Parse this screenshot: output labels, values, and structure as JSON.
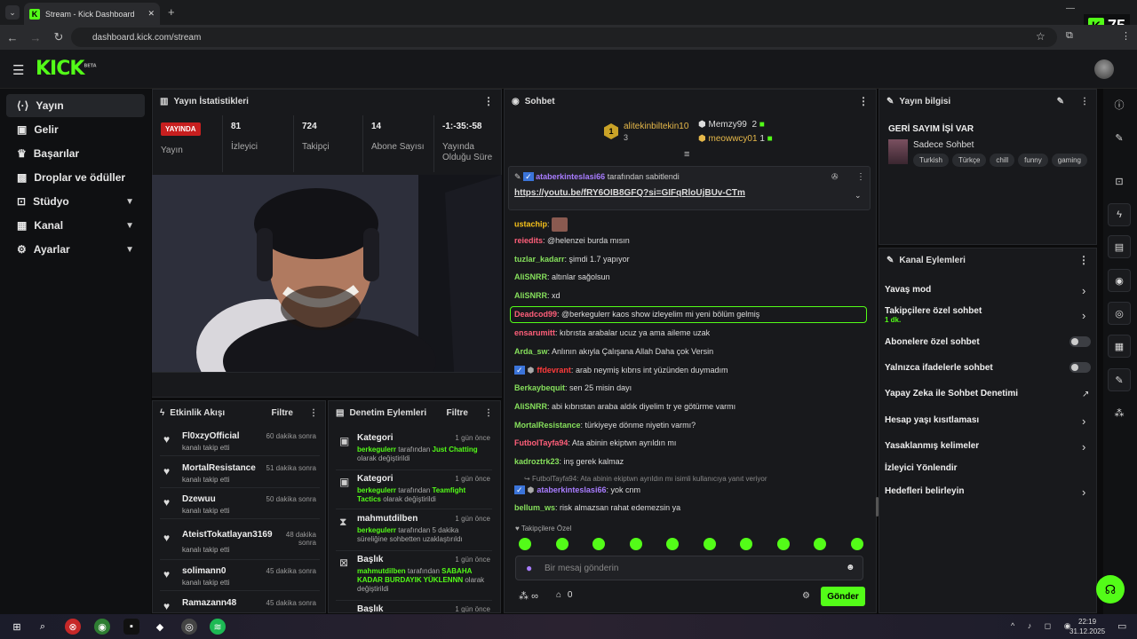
{
  "browser": {
    "tab_title": "Stream - Kick Dashboard",
    "url": "dashboard.kick.com/stream",
    "overlay_number": "75"
  },
  "site": {
    "logo": "KICK",
    "logo_sup": "BETA"
  },
  "nav": [
    {
      "label": "Yayın",
      "icon": "broadcast-icon"
    },
    {
      "label": "Gelir",
      "icon": "wallet-icon"
    },
    {
      "label": "Başarılar",
      "icon": "trophy-icon"
    },
    {
      "label": "Droplar ve ödüller",
      "icon": "gift-icon"
    },
    {
      "label": "Stüdyo",
      "icon": "studio-icon"
    },
    {
      "label": "Kanal",
      "icon": "channel-icon"
    },
    {
      "label": "Ayarlar",
      "icon": "gear-icon"
    }
  ],
  "stats": {
    "title": "Yayın İstatistikleri",
    "live": "YAYINDA",
    "live_label": "Yayın",
    "viewers": "81",
    "viewers_label": "İzleyici",
    "followers": "724",
    "followers_label": "Takipçi",
    "subs": "14",
    "subs_label": "Abone Sayısı",
    "uptime": "-1:-35:-58",
    "uptime_label": "Yayında Olduğu Süre"
  },
  "activity": {
    "title": "Etkinlik Akışı",
    "filter": "Filtre",
    "items": [
      {
        "name": "Fl0xzyOfficial",
        "sub": "kanalı takip etti",
        "time": "60 dakika sonra"
      },
      {
        "name": "MortalResistance",
        "sub": "kanalı takip etti",
        "time": "51 dakika sonra"
      },
      {
        "name": "Dzewuu",
        "sub": "kanalı takip etti",
        "time": "50 dakika sonra"
      },
      {
        "name": "AteistTokatlayan3169",
        "sub": "kanalı takip etti",
        "time": "48 dakika sonra"
      },
      {
        "name": "solimann0",
        "sub": "kanalı takip etti",
        "time": "45 dakika sonra"
      },
      {
        "name": "Ramazann48",
        "sub": "",
        "time": "45 dakika sonra"
      }
    ]
  },
  "mod": {
    "title": "Denetim Eylemleri",
    "filter": "Filtre",
    "items": [
      {
        "title": "Kategori",
        "time": "1 gün önce",
        "user": "berkegulerr",
        "mid": " tarafından ",
        "target": "Just Chatting",
        "end": " olarak değiştirildi"
      },
      {
        "title": "Kategori",
        "time": "1 gün önce",
        "user": "berkegulerr",
        "mid": " tarafından ",
        "target": "Teamfight Tactics",
        "end": " olarak değiştirildi"
      },
      {
        "title": "mahmutdilben",
        "time": "1 gün önce",
        "user": "berkegulerr",
        "mid": " tarafından 5 dakika süreliğine sohbetten uzaklaştırıldı",
        "target": "",
        "end": ""
      },
      {
        "title": "Başlık",
        "time": "1 gün önce",
        "user": "mahmutdilben",
        "mid": " tarafından ",
        "target": "SABAHA KADAR BURDAYIK YÜKLENNN",
        "end": " olarak değiştirildi"
      },
      {
        "title": "Başlık",
        "time": "1 gün önce",
        "user": "",
        "mid": "",
        "target": "",
        "end": ""
      }
    ]
  },
  "chat": {
    "title": "Sohbet",
    "leaders": {
      "first": "alitekinbiltekin10",
      "first_count": "3",
      "second": "Memzy99",
      "second_count": "2",
      "third": "meowwcy01",
      "third_count": "1",
      "rank": "1"
    },
    "pinned_by": "ataberkinteslasi66",
    "pinned_text": "tarafından sabitlendi",
    "pinned_link": "https://youtu.be/fRY6OIB8GFQ?si=GIFqRloUjBUv-CTm",
    "messages": [
      {
        "user": "ustachip",
        "text": "",
        "color": "#f7c21b"
      },
      {
        "user": "reiedits",
        "text": "@helenzei burda mısın",
        "color": "#ff5f7a"
      },
      {
        "user": "tuzlar_kadarr",
        "text": "şimdi 1.7 yapıyor",
        "color": "#86e05c"
      },
      {
        "user": "AliSNRR",
        "text": "altınlar sağolsun",
        "color": "#86e05c"
      },
      {
        "user": "AliSNRR",
        "text": "xd",
        "color": "#86e05c"
      },
      {
        "user": "Deadcod99",
        "text": "@berkegulerr kaos show izleyelim mi yeni bölüm gelmiş",
        "color": "#ff5f7a"
      },
      {
        "user": "ensarumitt",
        "text": "kıbrısta arabalar ucuz ya ama aileme uzak",
        "color": "#ff5f7a"
      },
      {
        "user": "Arda_sw",
        "text": "Anlının akıyla Çalışana Allah Daha çok Versin",
        "color": "#86e05c"
      },
      {
        "user": "ffdevrant",
        "text": "arab neymiş kıbrıs int yüzünden duymadım",
        "color": "#ff3b3b"
      },
      {
        "user": "Berkaybequit",
        "text": "sen 25 misin dayı",
        "color": "#86e05c"
      },
      {
        "user": "AliSNRR",
        "text": "abi kıbrıstan araba aldık diyelim tr ye götürme varmı",
        "color": "#86e05c"
      },
      {
        "user": "MortalResistance",
        "text": "türkiyeye dönme niyetin varmı?",
        "color": "#86e05c"
      },
      {
        "user": "FutbolTayfa94",
        "text": "Ata abinin ekiptwn ayrıldın mı",
        "color": "#ff5f7a"
      },
      {
        "user": "kadroztrk23",
        "text": "inş gerek kalmaz",
        "color": "#86e05c"
      },
      {
        "user": "ataberkinteslasi66",
        "text": "yok cnm",
        "color": "#a87cff"
      },
      {
        "user": "bellum_ws",
        "text": "risk almazsan rahat edemezsin ya",
        "color": "#86e05c"
      }
    ],
    "reply_ref": "FutbolTayfa94: Ata abinin ekiptwn ayrıldın mı isimli kullanıcıya yanıt veriyor",
    "followers_only": "Takipçilere Özel",
    "input_placeholder": "Bir mesaj gönderin",
    "points": "∞",
    "count": "0",
    "send": "Gönder"
  },
  "info": {
    "title": "Yayın bilgisi",
    "stream_title": "GERİ SAYIM İŞİ VAR",
    "category": "Sadece Sohbet",
    "tags": [
      "Turkish",
      "Türkçe",
      "chill",
      "funny",
      "gaming"
    ]
  },
  "channel": {
    "title": "Kanal Eylemleri",
    "items": [
      {
        "label": "Yavaş mod",
        "sub": "",
        "kind": "chevron"
      },
      {
        "label": "Takipçilere özel sohbet",
        "sub": "1 dk.",
        "kind": "chevron"
      },
      {
        "label": "Abonelere özel sohbet",
        "sub": "",
        "kind": "toggle"
      },
      {
        "label": "Yalnızca ifadelerle sohbet",
        "sub": "",
        "kind": "toggle"
      },
      {
        "label": "Yapay Zeka ile Sohbet Denetimi",
        "sub": "",
        "kind": "external"
      },
      {
        "label": "Hesap yaşı kısıtlaması",
        "sub": "",
        "kind": "chevron"
      },
      {
        "label": "Yasaklanmış kelimeler",
        "sub": "",
        "kind": "chevron"
      },
      {
        "label": "İzleyici Yönlendir",
        "sub": "",
        "kind": "none"
      },
      {
        "label": "Hedefleri belirleyin",
        "sub": "",
        "kind": "chevron"
      }
    ]
  },
  "taskbar": {
    "time": "22:19",
    "date": "31.12.2025"
  },
  "colors": {
    "accent": "#53fc18",
    "live": "#c71f1f"
  }
}
